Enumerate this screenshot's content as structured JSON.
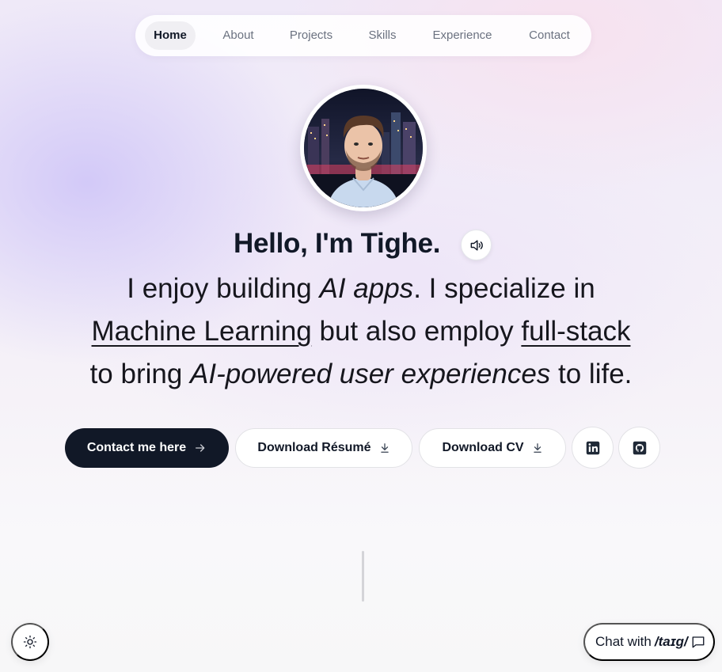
{
  "nav": {
    "items": [
      {
        "label": "Home",
        "active": true
      },
      {
        "label": "About"
      },
      {
        "label": "Projects"
      },
      {
        "label": "Skills"
      },
      {
        "label": "Experience"
      },
      {
        "label": "Contact"
      }
    ]
  },
  "hero": {
    "greeting": "Hello, I'm Tighe.",
    "bio": {
      "p1": "I enjoy building ",
      "em1": "AI apps",
      "p2": ". I specialize in",
      "link1": "Machine Learning",
      "p3": " but also employ ",
      "link2": "full-stack",
      "p4": "to bring ",
      "em2": "AI-powered user experiences",
      "p5": " to life."
    },
    "avatar_icon": "profile-photo"
  },
  "actions": {
    "contact_label": "Contact me here",
    "resume_label": "Download Résumé",
    "cv_label": "Download CV",
    "linkedin_icon": "linkedin-icon",
    "github_icon": "github-icon"
  },
  "widgets": {
    "theme_icon": "sun-icon",
    "chat_prefix": "Chat with",
    "chat_brand": "/taɪg/",
    "chat_icon": "message-icon"
  },
  "colors": {
    "primary_dark": "#111827",
    "text_muted": "#6b7280"
  }
}
